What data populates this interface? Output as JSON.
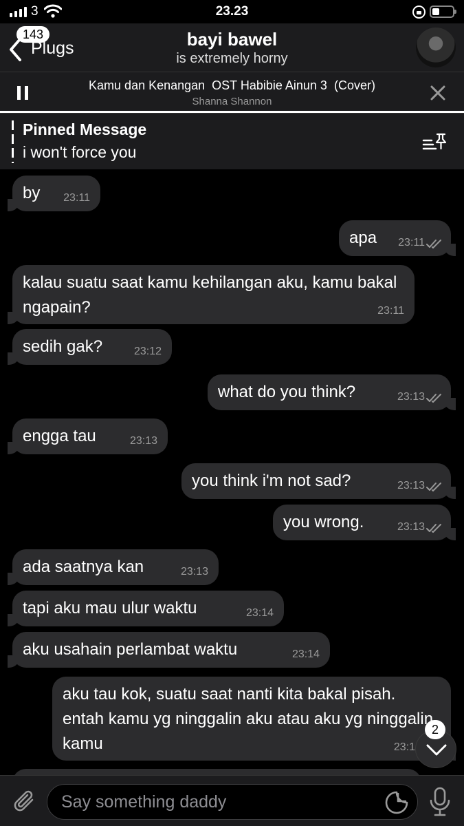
{
  "status_bar": {
    "carrier": "3",
    "time": "23.23"
  },
  "header": {
    "unread_count": "143",
    "back_label": "Plugs",
    "title": "bayi bawel",
    "subtitle": "is extremely horny"
  },
  "player": {
    "track": "Kamu dan Kenangan  OST Habibie Ainun 3  (Cover)",
    "artist": "Shanna Shannon",
    "progress": 1.0
  },
  "pinned": {
    "title": "Pinned Message",
    "text": "i won't force you"
  },
  "messages": [
    {
      "dir": "in",
      "text": "by",
      "time": "23:11"
    },
    {
      "dir": "out",
      "text": "apa",
      "time": "23:11",
      "read": true
    },
    {
      "dir": "in",
      "text": "kalau suatu saat kamu kehilangan aku, kamu bakal ngapain?",
      "time": "23:11"
    },
    {
      "dir": "in",
      "text": "sedih gak?",
      "time": "23:12"
    },
    {
      "dir": "out",
      "text": "what do you think?",
      "time": "23:13",
      "read": true
    },
    {
      "dir": "in",
      "text": "engga tau",
      "time": "23:13"
    },
    {
      "dir": "out",
      "text": "you think i'm not sad?",
      "time": "23:13",
      "read": true
    },
    {
      "dir": "out",
      "text": "you wrong.",
      "time": "23:13",
      "read": true
    },
    {
      "dir": "in",
      "text": "ada saatnya kan",
      "time": "23:13"
    },
    {
      "dir": "in",
      "text": "tapi aku mau ulur waktu",
      "time": "23:14"
    },
    {
      "dir": "in",
      "text": "aku usahain perlambat waktu",
      "time": "23:14"
    },
    {
      "dir": "out",
      "text": "aku tau kok, suatu saat nanti kita bakal pisah. entah kamu yg ninggalin aku atau aku yg ninggalin kamu",
      "time": "23:1"
    }
  ],
  "scroll_down": {
    "count": "2"
  },
  "input": {
    "placeholder": "Say something daddy"
  },
  "icons": {
    "back": "chevron-left-icon",
    "pause": "pause-icon",
    "close": "close-icon",
    "pinned_list": "pinned-list-icon",
    "attach": "paperclip-icon",
    "sticker": "sticker-icon",
    "mic": "microphone-icon",
    "scroll": "chevron-down-icon"
  }
}
